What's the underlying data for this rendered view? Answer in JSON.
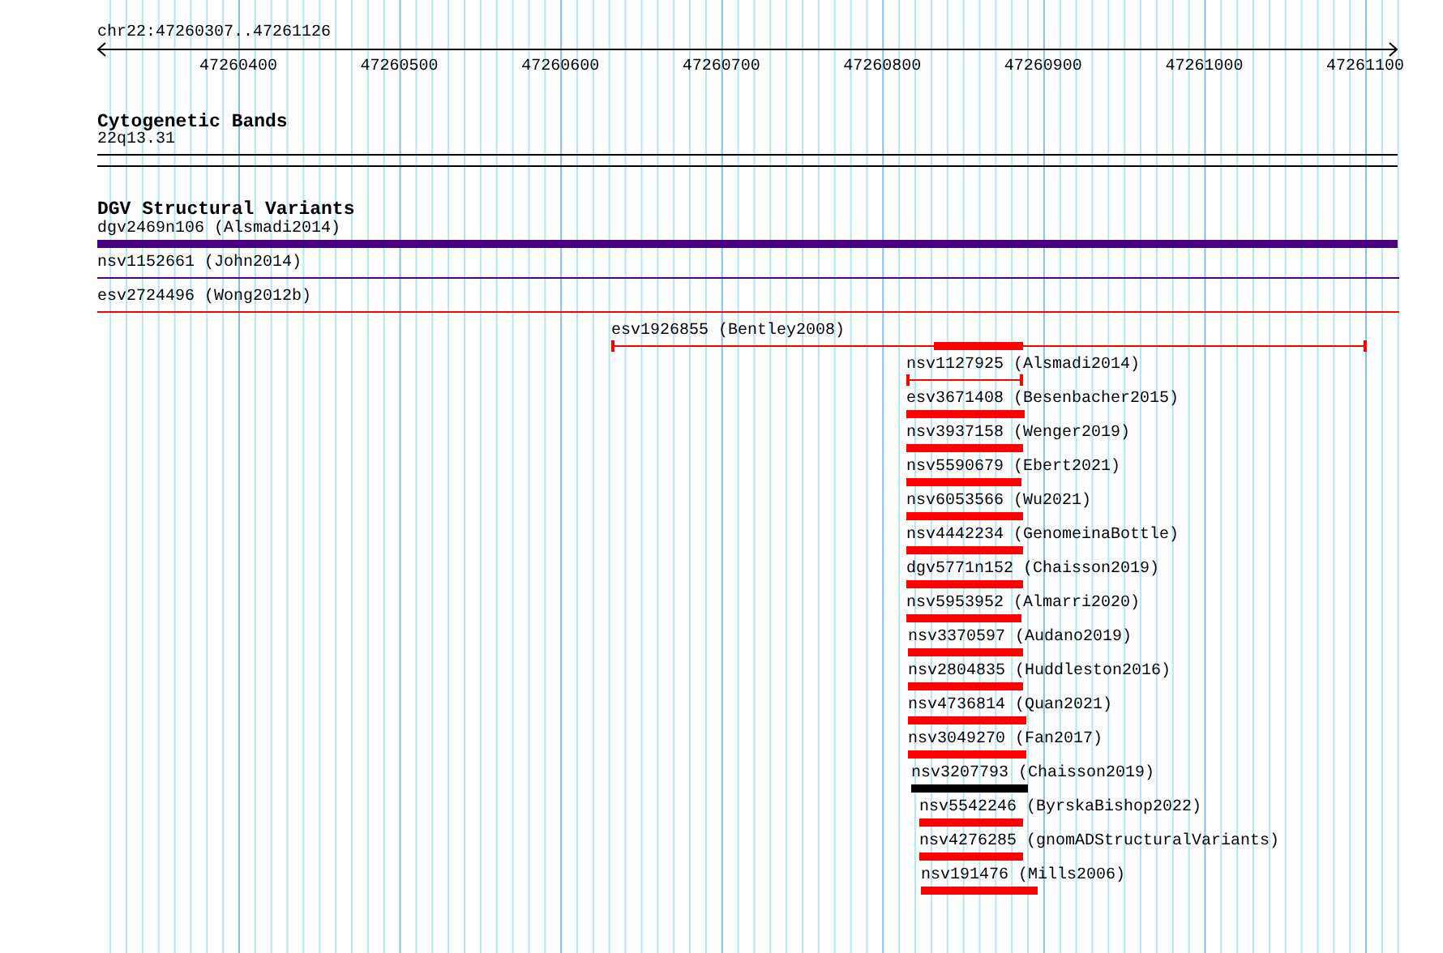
{
  "ruler": {
    "location": "chr22:47260307..47261126",
    "ticks": [
      "47260400",
      "47260500",
      "47260600",
      "47260700",
      "47260800",
      "47260900",
      "47261000",
      "47261100"
    ]
  },
  "tracks": [
    {
      "kind": "cytoband",
      "title": "Cytogenetic Bands",
      "band": "22q13.31"
    },
    {
      "kind": "variants",
      "title": "DGV Structural Variants",
      "features": [
        {
          "name": "dgv2469n106 (Alsmadi2014)",
          "kind": "bar",
          "color": "#4b0082"
        },
        {
          "name": "nsv1152661 (John2014)",
          "kind": "line",
          "color": "#4b0082"
        },
        {
          "name": "esv2724496 (Wong2012b)",
          "kind": "line",
          "color": "#ff0000"
        },
        {
          "name": "esv1926855 (Bentley2008)",
          "kind": "compound",
          "color": "#ff0000"
        },
        {
          "name": "nsv1127925 (Alsmadi2014)",
          "kind": "line",
          "color": "#ff0000"
        },
        {
          "name": "esv3671408 (Besenbacher2015)",
          "kind": "bar",
          "color": "#ff0000"
        },
        {
          "name": "nsv3937158 (Wenger2019)",
          "kind": "bar",
          "color": "#ff0000"
        },
        {
          "name": "nsv5590679 (Ebert2021)",
          "kind": "bar",
          "color": "#ff0000"
        },
        {
          "name": "nsv6053566 (Wu2021)",
          "kind": "bar",
          "color": "#ff0000"
        },
        {
          "name": "nsv4442234 (GenomeinaBottle)",
          "kind": "bar",
          "color": "#ff0000"
        },
        {
          "name": "dgv5771n152 (Chaisson2019)",
          "kind": "bar",
          "color": "#ff0000"
        },
        {
          "name": "nsv5953952 (Almarri2020)",
          "kind": "bar",
          "color": "#ff0000"
        },
        {
          "name": "nsv3370597 (Audano2019)",
          "kind": "bar",
          "color": "#ff0000"
        },
        {
          "name": "nsv2804835 (Huddleston2016)",
          "kind": "bar",
          "color": "#ff0000"
        },
        {
          "name": "nsv4736814 (Quan2021)",
          "kind": "bar",
          "color": "#ff0000"
        },
        {
          "name": "nsv3049270 (Fan2017)",
          "kind": "bar",
          "color": "#ff0000"
        },
        {
          "name": "nsv3207793 (Chaisson2019)",
          "kind": "bar",
          "color": "#000000"
        },
        {
          "name": "nsv5542246 (ByrskaBishop2022)",
          "kind": "bar",
          "color": "#ff0000"
        },
        {
          "name": "nsv4276285 (gnomADStructuralVariants)",
          "kind": "bar",
          "color": "#ff0000"
        },
        {
          "name": "nsv191476 (Mills2006)",
          "kind": "bar",
          "color": "#ff0000"
        }
      ]
    }
  ]
}
